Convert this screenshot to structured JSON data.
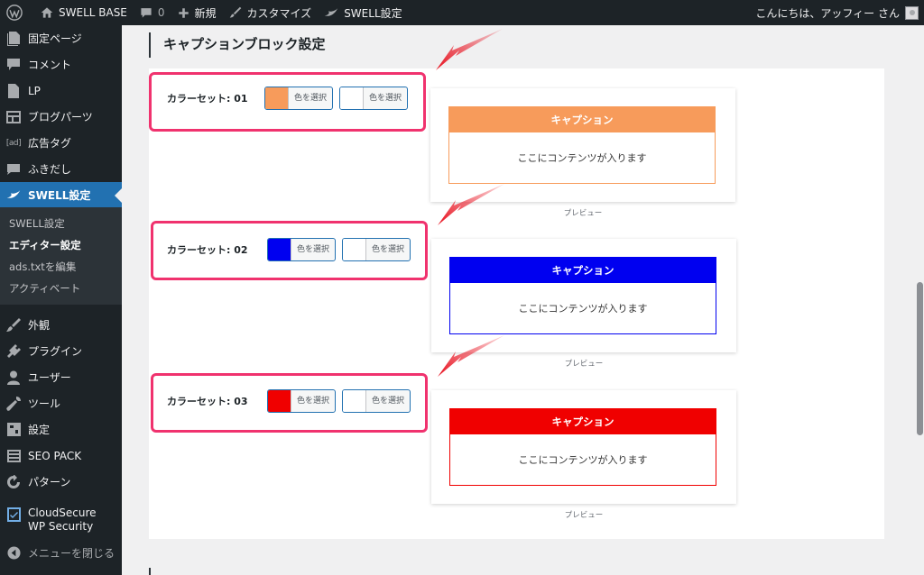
{
  "adminbar": {
    "site_name": "SWELL BASE",
    "comments_count": "0",
    "new_label": "新規",
    "customize_label": "カスタマイズ",
    "swell_settings_label": "SWELL設定",
    "greeting": "こんにちは、アッフィー さん"
  },
  "sidebar": {
    "items_top": [
      {
        "label": "固定ページ",
        "icon": "page-icon"
      },
      {
        "label": "コメント",
        "icon": "comment-icon"
      },
      {
        "label": "LP",
        "icon": "lp-icon"
      },
      {
        "label": "ブログパーツ",
        "icon": "blog-parts-icon"
      },
      {
        "label": "広告タグ",
        "icon": "ad-icon"
      },
      {
        "label": "ふきだし",
        "icon": "balloon-icon"
      }
    ],
    "active": {
      "label": "SWELL設定",
      "icon": "swell-icon"
    },
    "submenu": [
      "SWELL設定",
      "エディター設定",
      "ads.txtを編集",
      "アクティベート"
    ],
    "items_bottom": [
      {
        "label": "外観",
        "icon": "appearance-icon"
      },
      {
        "label": "プラグイン",
        "icon": "plugin-icon"
      },
      {
        "label": "ユーザー",
        "icon": "user-icon"
      },
      {
        "label": "ツール",
        "icon": "tool-icon"
      },
      {
        "label": "設定",
        "icon": "settings-icon"
      },
      {
        "label": "SEO PACK",
        "icon": "seo-icon"
      },
      {
        "label": "パターン",
        "icon": "pattern-icon"
      }
    ],
    "cloudsecure": "CloudSecure WP Security",
    "collapse": "メニューを閉じる"
  },
  "main": {
    "section_title": "キャプションブロック設定",
    "select_color_label": "色を選択",
    "sets": [
      {
        "label": "カラーセット: 01",
        "color": "#f79b5b",
        "bg_color": "#ffffff",
        "caption": "キャプション",
        "content": "ここにコンテンツが入ります",
        "preview_label": "プレビュー"
      },
      {
        "label": "カラーセット: 02",
        "color": "#0000f0",
        "bg_color": "#ffffff",
        "caption": "キャプション",
        "content": "ここにコンテンツが入ります",
        "preview_label": "プレビュー"
      },
      {
        "label": "カラーセット: 03",
        "color": "#f00000",
        "bg_color": "#ffffff",
        "caption": "キャプション",
        "content": "ここにコンテンツが入ります",
        "preview_label": "プレビュー"
      }
    ],
    "highlight_color": "#f0326e",
    "arrow_color": "#e8101e"
  }
}
